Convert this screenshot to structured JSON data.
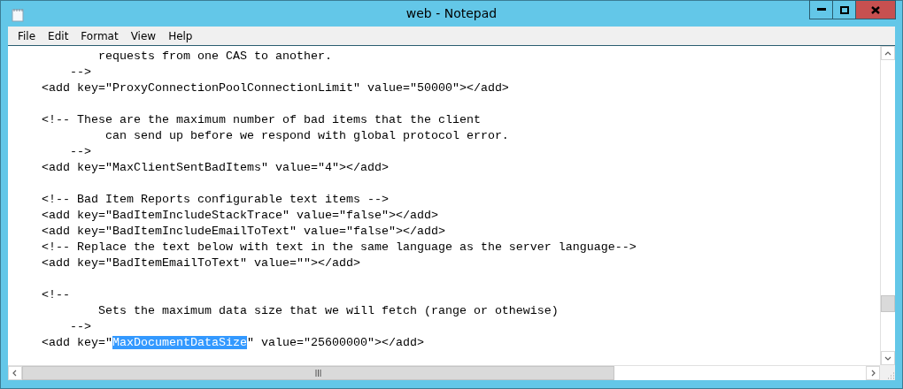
{
  "window": {
    "title": "web - Notepad"
  },
  "menu": [
    {
      "label": "File"
    },
    {
      "label": "Edit"
    },
    {
      "label": "Format"
    },
    {
      "label": "View"
    },
    {
      "label": "Help"
    }
  ],
  "editor": {
    "lines": [
      {
        "kind": "text",
        "text": "            requests from one CAS to another."
      },
      {
        "kind": "text",
        "text": "        -->"
      },
      {
        "kind": "text",
        "text": "    <add key=\"ProxyConnectionPoolConnectionLimit\" value=\"50000\"></add>"
      },
      {
        "kind": "blank"
      },
      {
        "kind": "text",
        "text": "    <!-- These are the maximum number of bad items that the client"
      },
      {
        "kind": "text",
        "text": "             can send up before we respond with global protocol error."
      },
      {
        "kind": "text",
        "text": "        -->"
      },
      {
        "kind": "text",
        "text": "    <add key=\"MaxClientSentBadItems\" value=\"4\"></add>"
      },
      {
        "kind": "blank"
      },
      {
        "kind": "text",
        "text": "    <!-- Bad Item Reports configurable text items -->"
      },
      {
        "kind": "text",
        "text": "    <add key=\"BadItemIncludeStackTrace\" value=\"false\"></add>"
      },
      {
        "kind": "text",
        "text": "    <add key=\"BadItemIncludeEmailToText\" value=\"false\"></add>"
      },
      {
        "kind": "text",
        "text": "    <!-- Replace the text below with text in the same language as the server language-->"
      },
      {
        "kind": "text",
        "text": "    <add key=\"BadItemEmailToText\" value=\"\"></add>"
      },
      {
        "kind": "blank"
      },
      {
        "kind": "text",
        "text": "    <!--"
      },
      {
        "kind": "text",
        "text": "            Sets the maximum data size that we will fetch (range or othewise)"
      },
      {
        "kind": "text",
        "text": "        -->"
      },
      {
        "kind": "selection",
        "before": "    <add key=\"",
        "selected": "MaxDocumentDataSize",
        "after": "\" value=\"25600000\"></add>"
      }
    ]
  }
}
